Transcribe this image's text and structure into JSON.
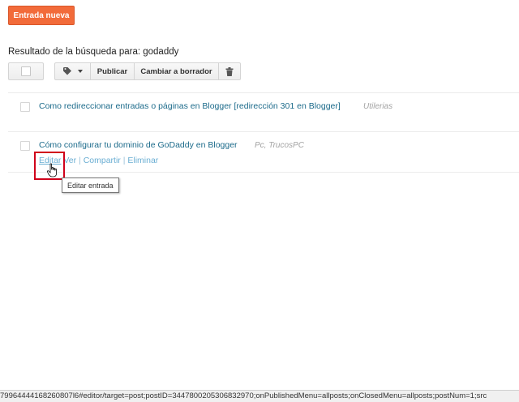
{
  "toolbar": {
    "new_post_label": "Entrada nueva",
    "publish_label": "Publicar",
    "revert_draft_label": "Cambiar a borrador"
  },
  "search": {
    "result_label": "Resultado de la búsqueda para: godaddy"
  },
  "posts": [
    {
      "title": "Como redireccionar entradas o páginas en Blogger [redirección 301 en Blogger]",
      "labels": "Utilerias"
    },
    {
      "title": "Cómo configurar tu dominio de GoDaddy en Blogger",
      "labels": "Pc, TrucosPC",
      "actions": {
        "edit": "Editar",
        "view": "Ver",
        "share": "Compartir",
        "delete": "Eliminar",
        "separator": "|"
      }
    }
  ],
  "tooltip": "Editar entrada",
  "status_bar": "79964444168260807l6#editor/target=post;postID=3447800205306832970;onPublishedMenu=allposts;onClosedMenu=allposts;postNum=1;src",
  "colors": {
    "primary_button": "#f26b3a",
    "link": "#1b6a8a",
    "highlight_border": "#d0021b"
  }
}
